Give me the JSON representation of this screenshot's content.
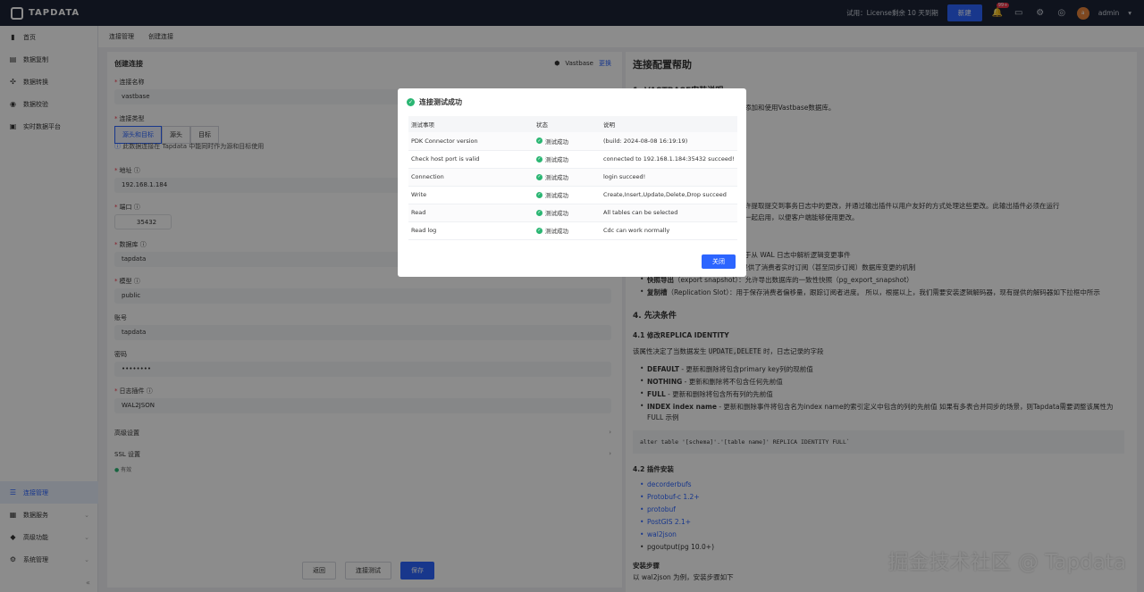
{
  "topbar": {
    "brand": "TAPDATA",
    "license": "试用：License剩余 10 天到期",
    "new_label": "新建",
    "notify_badge": "99+",
    "user": "admin",
    "avatar_letter": "a"
  },
  "sidebar": {
    "top_items": [
      {
        "label": "首页",
        "icon": "home-icon"
      },
      {
        "label": "数据复制",
        "icon": "copy-icon"
      },
      {
        "label": "数据转换",
        "icon": "transform-icon"
      },
      {
        "label": "数据校验",
        "icon": "check-icon"
      },
      {
        "label": "实时数据平台",
        "icon": "platform-icon"
      }
    ],
    "bottom_items": [
      {
        "label": "连接管理",
        "icon": "connection-icon"
      },
      {
        "label": "数据服务",
        "icon": "service-icon"
      },
      {
        "label": "高级功能",
        "icon": "advanced-icon"
      },
      {
        "label": "系统管理",
        "icon": "system-icon"
      }
    ]
  },
  "breadcrumb": {
    "first": "连接管理",
    "second": "创建连接"
  },
  "form": {
    "title": "创建连接",
    "db_name": "Vastbase",
    "swap_label": "更换",
    "name_label": "连接名称",
    "name_value": "vastbase",
    "type_label": "连接类型",
    "type_options": [
      "源头和目标",
      "源头",
      "目标"
    ],
    "type_hint": "此数据连接在 Tapdata 中能同时作为源和目标使用",
    "host_label": "地址",
    "host_value": "192.168.1.184",
    "port_label": "端口",
    "port_value": "35432",
    "db_label": "数据库",
    "db_value": "tapdata",
    "schema_label": "模型",
    "schema_value": "public",
    "user_label": "账号",
    "user_value": "tapdata",
    "password_label": "密码",
    "password_value": "••••••••",
    "plugin_label": "日志插件",
    "plugin_value": "WAL2JSON",
    "advanced_label": "高级设置",
    "ssl_label": "SSL 设置",
    "valid_label": "有效",
    "back_label": "返回",
    "test_label": "连接测试",
    "save_label": "保存"
  },
  "help": {
    "title": "连接配置帮助",
    "section1": "1. VASTBASE安装说明",
    "intro": "成功添加和使用Vastbase数据库。",
    "para1": "，允许提取提交到事务日志中的更改，并通过输出插件以用户友好的方式处理这些更改。此输出插件必须在运行",
    "para2": "制槽一起启用，以便客户端能够使用更改。",
    "bullet0": "：用于从 WAL 日志中解析逻辑变更事件",
    "bullet1": "）：提供了消费者实时订阅（甚至同步订阅）数据库变更的机制",
    "bullet2_bold": "快照导出",
    "bullet2": "（export snapshot）：允许导出数据库的一致性快照（pg_export_snapshot）",
    "bullet3_bold": "复制槽",
    "bullet3": "（Replication Slot）：用于保存消费者偏移量，跟踪订阅者进度。 所以，根据以上，我们需要安装逻辑解码器，现有提供的解码器如下拉框中所示",
    "section4": "4. 先决条件",
    "section41": "4.1 修改REPLICA IDENTITY",
    "para41_a": "该属性决定了当数据发生",
    "para41_code": "UPDATE,DELETE",
    "para41_b": "时，日志记录的字段",
    "ri_items": [
      {
        "bold": "DEFAULT",
        "text": " - 更新和删除将包含primary key列的现前值"
      },
      {
        "bold": "NOTHING",
        "text": " - 更新和删除将不包含任何先前值"
      },
      {
        "bold": "FULL",
        "text": " - 更新和删除将包含所有列的先前值"
      },
      {
        "bold": "INDEX index name",
        "text": " - 更新和删除事件将包含名为index name的索引定义中包含的列的先前值 如果有多表合并同步的场景，则Tapdata需要调整该属性为"
      }
    ],
    "ri_tail": "FULL 示例",
    "code": "alter table '[schema]'.'[table name]' REPLICA IDENTITY FULL`",
    "section42": "4.2 插件安装",
    "plugins": [
      "decorderbufs",
      "Protobuf-c 1.2+",
      "protobuf",
      "PostGIS 2.1+",
      "wal2json"
    ],
    "plugin_plain": "pgoutput(pg 10.0+)",
    "install_title": "安装步骤",
    "install_text": "以 wal2json 为例，安装步骤如下",
    "watermark": "掘金技术社区 @ Tapdata"
  },
  "modal": {
    "title": "连接测试成功",
    "headers": [
      "测试事项",
      "状态",
      "说明"
    ],
    "rows": [
      {
        "item": "PDK Connector version",
        "status": "测试成功",
        "desc": "(build: 2024-08-08 16:19:19)"
      },
      {
        "item": "Check host port is valid",
        "status": "测试成功",
        "desc": "connected to 192.168.1.184:35432 succeed!"
      },
      {
        "item": "Connection",
        "status": "测试成功",
        "desc": "login succeed!"
      },
      {
        "item": "Write",
        "status": "测试成功",
        "desc": "Create,Insert,Update,Delete,Drop succeed"
      },
      {
        "item": "Read",
        "status": "测试成功",
        "desc": "All tables can be selected"
      },
      {
        "item": "Read log",
        "status": "测试成功",
        "desc": "Cdc can work normally"
      }
    ],
    "close_label": "关闭"
  },
  "colors": {
    "accent": "#2c65ff",
    "success": "#2bb673",
    "topbar": "#1c2435"
  }
}
